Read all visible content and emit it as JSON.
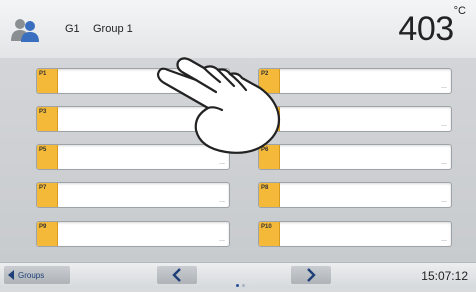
{
  "header": {
    "group_code": "G1",
    "group_name": "Group 1",
    "temperature": "403",
    "temperature_unit": "°C",
    "icon": "users-icon"
  },
  "programs": [
    {
      "label": "P1",
      "value": ""
    },
    {
      "label": "P2",
      "value": "..."
    },
    {
      "label": "P3",
      "value": ""
    },
    {
      "label": "P4",
      "value": "..."
    },
    {
      "label": "P5",
      "value": "..."
    },
    {
      "label": "P6",
      "value": "..."
    },
    {
      "label": "P7",
      "value": "..."
    },
    {
      "label": "P8",
      "value": "..."
    },
    {
      "label": "P9",
      "value": "..."
    },
    {
      "label": "P10",
      "value": "..."
    }
  ],
  "footer": {
    "groups_label": "Groups",
    "prev_icon": "chevron-left-icon",
    "next_icon": "chevron-right-icon",
    "page_count": 2,
    "current_page": 1,
    "time": "15:07:12"
  },
  "colors": {
    "tag": "#f5b93a",
    "nav": "#1f3f78",
    "page_active": "#2a4fa0",
    "page_inactive": "#a9b4c8"
  }
}
